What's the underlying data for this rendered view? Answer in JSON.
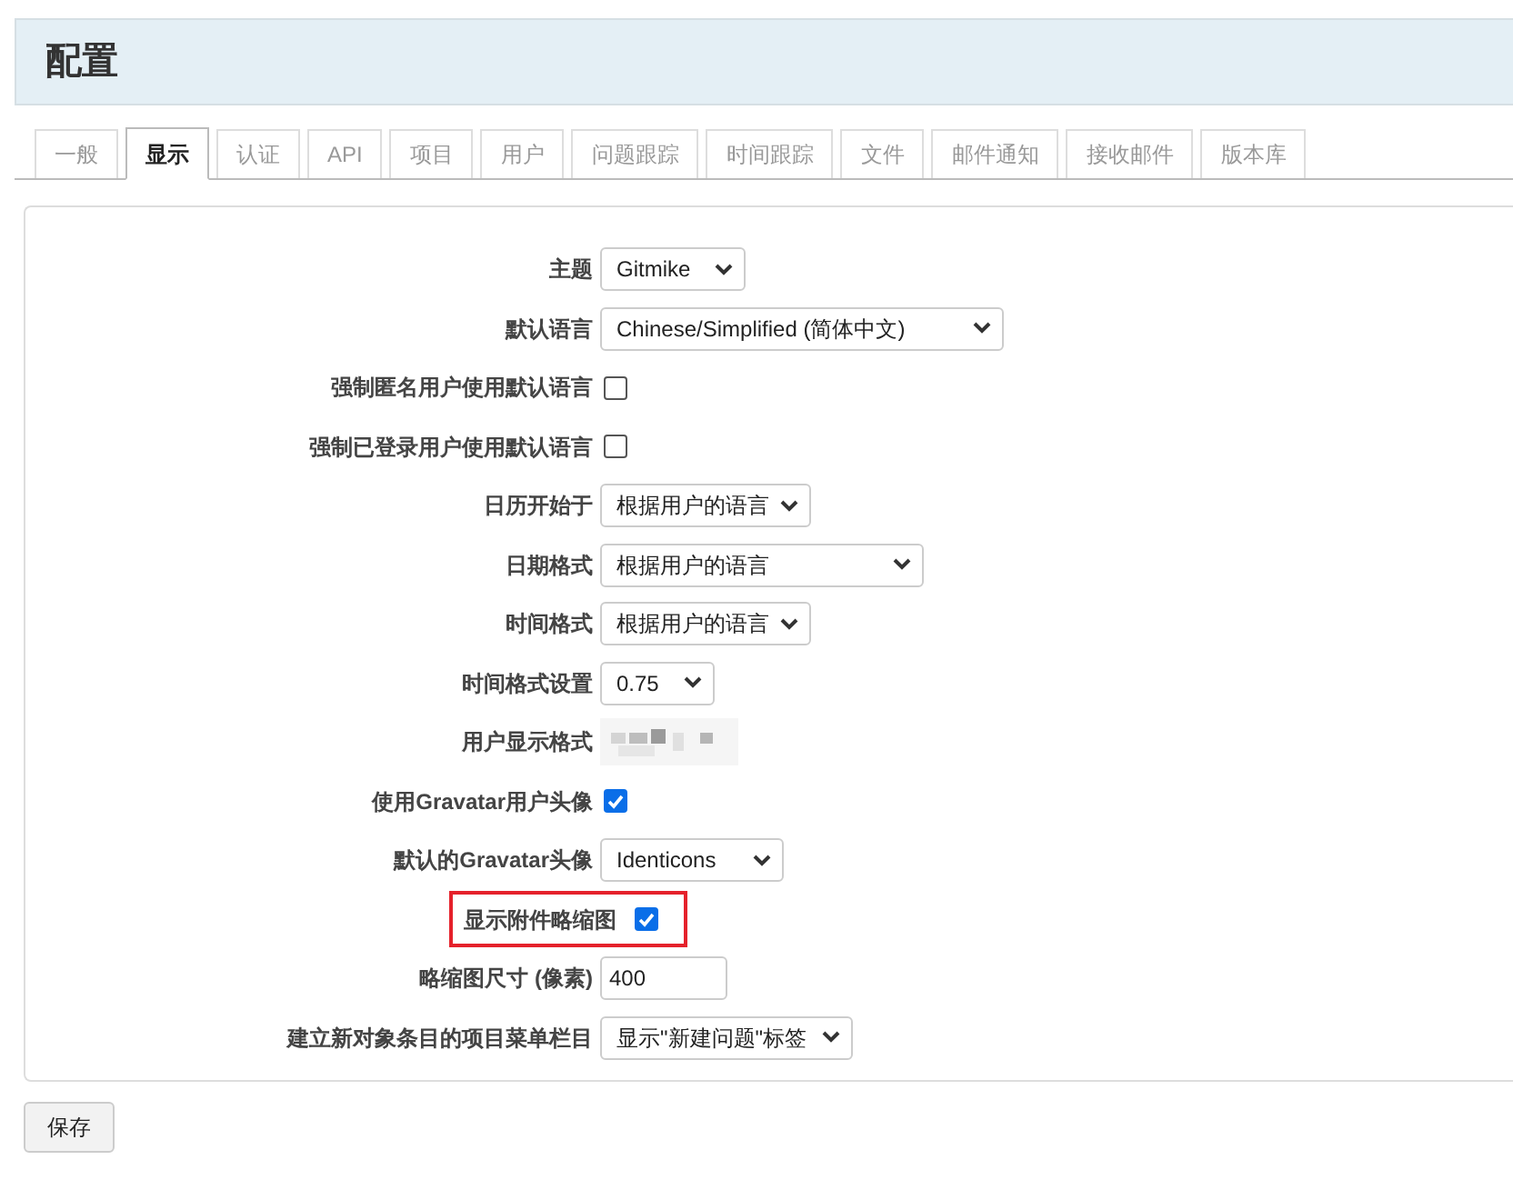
{
  "title": "配置",
  "tabs": [
    {
      "label": "一般",
      "selected": false
    },
    {
      "label": "显示",
      "selected": true
    },
    {
      "label": "认证",
      "selected": false
    },
    {
      "label": "API",
      "selected": false
    },
    {
      "label": "项目",
      "selected": false
    },
    {
      "label": "用户",
      "selected": false
    },
    {
      "label": "问题跟踪",
      "selected": false
    },
    {
      "label": "时间跟踪",
      "selected": false
    },
    {
      "label": "文件",
      "selected": false
    },
    {
      "label": "邮件通知",
      "selected": false
    },
    {
      "label": "接收邮件",
      "selected": false
    },
    {
      "label": "版本库",
      "selected": false
    }
  ],
  "settings": [
    {
      "label": "主题",
      "kind": "select",
      "value": "Gitmike"
    },
    {
      "label": "默认语言",
      "kind": "select",
      "value": "Chinese/Simplified (简体中文)"
    },
    {
      "label": "强制匿名用户使用默认语言",
      "kind": "checkbox",
      "checked": false
    },
    {
      "label": "强制已登录用户使用默认语言",
      "kind": "checkbox",
      "checked": false
    },
    {
      "label": "日历开始于",
      "kind": "select",
      "value": "根据用户的语言"
    },
    {
      "label": "日期格式",
      "kind": "select",
      "value": "根据用户的语言"
    },
    {
      "label": "时间格式",
      "kind": "select",
      "value": "根据用户的语言"
    },
    {
      "label": "时间格式设置",
      "kind": "select",
      "value": "0.75"
    },
    {
      "label": "用户显示格式",
      "kind": "picture"
    },
    {
      "label": "使用Gravatar用户头像",
      "kind": "checkbox",
      "checked": true
    },
    {
      "label": "默认的Gravatar头像",
      "kind": "select",
      "value": "Identicons"
    },
    {
      "label": "显示附件略缩图",
      "kind": "checkbox",
      "checked": true,
      "highlighted": true
    },
    {
      "label": "略缩图尺寸 (像素)",
      "kind": "input",
      "value": "400"
    },
    {
      "label": "建立新对象条目的项目菜单栏目",
      "kind": "select",
      "value": "显示\"新建问题\"标签"
    }
  ],
  "save_button": "保存"
}
